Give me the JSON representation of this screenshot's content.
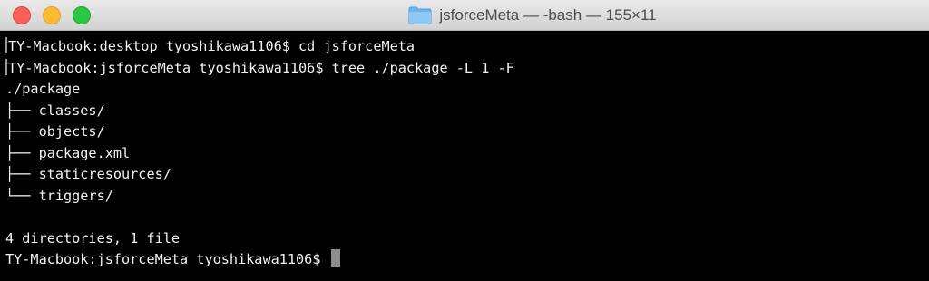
{
  "window": {
    "title": "jsforceMeta — -bash — 155×11",
    "colors": {
      "close": "#fc5f57",
      "minimize": "#fdbc2e",
      "zoom": "#29c840",
      "background": "#000000",
      "text": "#f2f2f2"
    }
  },
  "terminal": {
    "lines": [
      "TY-Macbook:desktop tyoshikawa1106$ cd jsforceMeta",
      "TY-Macbook:jsforceMeta tyoshikawa1106$ tree ./package -L 1 -F",
      "./package",
      "├── classes/",
      "├── objects/",
      "├── package.xml",
      "├── staticresources/",
      "└── triggers/",
      "",
      "4 directories, 1 file",
      "TY-Macbook:jsforceMeta tyoshikawa1106$ "
    ]
  }
}
